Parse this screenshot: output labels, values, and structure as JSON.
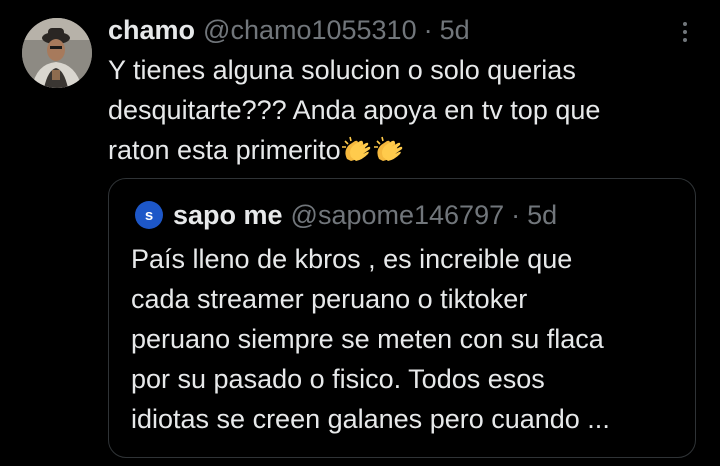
{
  "tweet": {
    "author_name": "chamo",
    "handle": "@chamo1055310",
    "separator": "·",
    "time": "5d",
    "text": "Y tienes alguna solucion o solo querias\ndesquitarte??? Anda apoya en tv top que\nraton esta primerito",
    "emojis": [
      "clapping-hands",
      "clapping-hands"
    ],
    "more_icon": "more-vertical-icon"
  },
  "quote": {
    "avatar_letter": "s",
    "author_name": "sapo me",
    "handle": "@sapome146797",
    "separator": "·",
    "time": "5d",
    "text": "País lleno de kbros , es increible que\ncada streamer peruano o tiktoker\nperuano siempre se meten con su flaca\npor su pasado o fisico. Todos esos\nidiotas se creen galanes pero cuando ..."
  },
  "colors": {
    "background": "#000000",
    "text_primary": "#e7e9ea",
    "text_secondary": "#71767b",
    "border": "#2f3336",
    "quote_avatar": "#1d57c8"
  }
}
